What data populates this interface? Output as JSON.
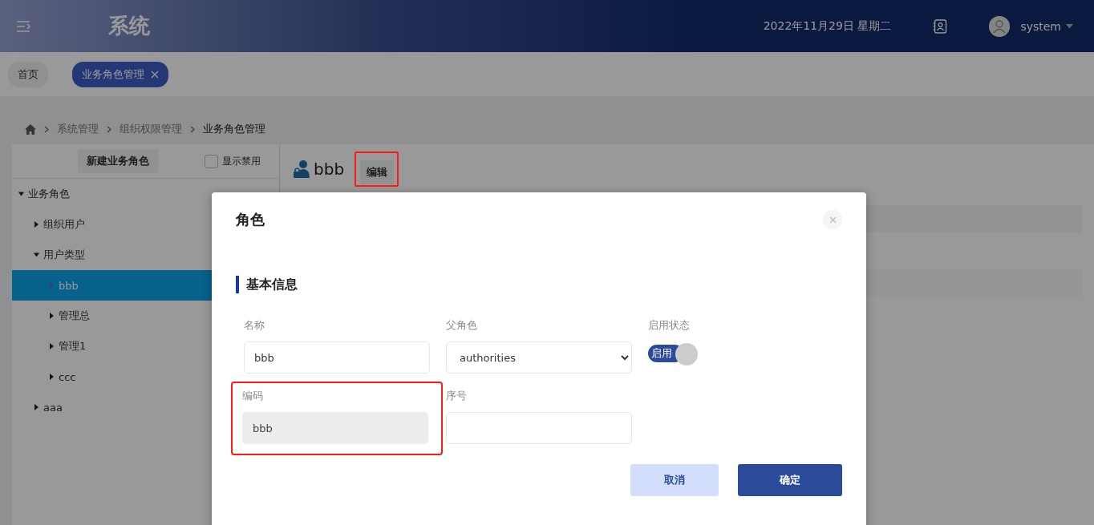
{
  "header": {
    "title": "系统",
    "date": "2022年11月29日 星期二",
    "user": "system"
  },
  "tabs": [
    {
      "label": "首页",
      "selected": false,
      "closable": false
    },
    {
      "label": "业务角色管理",
      "selected": true,
      "closable": true
    }
  ],
  "breadcrumb": [
    "系统管理",
    "组织权限管理",
    "业务角色管理"
  ],
  "sidebar": {
    "new_button": "新建业务角色",
    "show_disabled": {
      "label": "显示禁用",
      "checked": false
    },
    "tree": [
      {
        "label": "业务角色",
        "expanded": true,
        "selected": false,
        "children": [
          {
            "label": "组织用户",
            "expanded": false,
            "selected": false
          },
          {
            "label": "用户类型",
            "expanded": true,
            "selected": false,
            "children": [
              {
                "label": "bbb",
                "expanded": false,
                "selected": true
              },
              {
                "label": "管理总",
                "expanded": false,
                "selected": false
              },
              {
                "label": "管理1",
                "expanded": false,
                "selected": false
              },
              {
                "label": "ccc",
                "expanded": false,
                "selected": false
              }
            ]
          },
          {
            "label": "aaa",
            "expanded": false,
            "selected": false
          }
        ]
      }
    ]
  },
  "detail": {
    "name": "bbb",
    "edit_button": "编辑",
    "edit_highlighted": true
  },
  "dialog": {
    "title": "角色",
    "section": "基本信息",
    "fields": [
      {
        "kind": "text",
        "label": "名称",
        "value": "bbb",
        "disabled": false,
        "highlighted": false
      },
      {
        "kind": "select",
        "label": "父角色",
        "value": "authorities",
        "highlighted": false
      },
      {
        "kind": "toggle",
        "label": "启用状态",
        "toggle_label": "启用",
        "on": true,
        "highlighted": false
      },
      {
        "kind": "text",
        "label": "编码",
        "value": "bbb",
        "disabled": true,
        "highlighted": true
      },
      {
        "kind": "text",
        "label": "序号",
        "disabled": false,
        "highlighted": false
      }
    ],
    "buttons": [
      {
        "label": "取消",
        "kind": "secondary"
      },
      {
        "label": "确定",
        "kind": "primary"
      }
    ]
  }
}
